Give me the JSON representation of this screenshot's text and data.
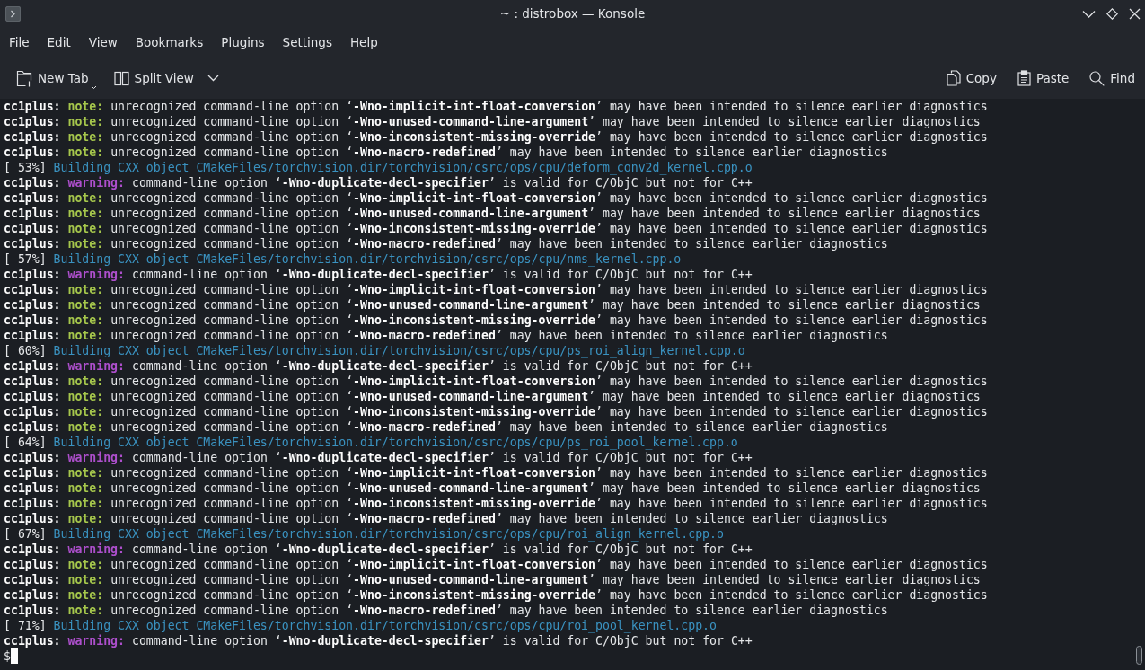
{
  "window": {
    "title": "~ : distrobox — Konsole"
  },
  "menu_bar": [
    "File",
    "Edit",
    "View",
    "Bookmarks",
    "Plugins",
    "Settings",
    "Help"
  ],
  "toolbar": {
    "left": [
      {
        "kind": "new-tab",
        "label": "New Tab",
        "has_menu": true,
        "split_button": false
      },
      {
        "kind": "split-view",
        "label": "Split View",
        "has_menu": true,
        "split_button": true
      }
    ],
    "right": [
      {
        "kind": "copy",
        "label": "Copy"
      },
      {
        "kind": "paste",
        "label": "Paste"
      },
      {
        "kind": "find",
        "label": "Find"
      }
    ]
  },
  "terminal": {
    "lines": [
      {
        "kind": "note",
        "source": "cc1plus:",
        "severity": "note:",
        "message": "unrecognized command-line option ‘**-Wno-implicit-int-float-conversion**’ may have been intended to silence earlier diagnostics"
      },
      {
        "kind": "note",
        "source": "cc1plus:",
        "severity": "note:",
        "message": "unrecognized command-line option ‘**-Wno-unused-command-line-argument**’ may have been intended to silence earlier diagnostics"
      },
      {
        "kind": "note",
        "source": "cc1plus:",
        "severity": "note:",
        "message": "unrecognized command-line option ‘**-Wno-inconsistent-missing-override**’ may have been intended to silence earlier diagnostics"
      },
      {
        "kind": "note",
        "source": "cc1plus:",
        "severity": "note:",
        "message": "unrecognized command-line option ‘**-Wno-macro-redefined**’ may have been intended to silence earlier diagnostics"
      },
      {
        "kind": "progress",
        "percent": "[ 53%]",
        "message": "Building CXX object CMakeFiles/torchvision.dir/torchvision/csrc/ops/cpu/deform_conv2d_kernel.cpp.o"
      },
      {
        "kind": "warning",
        "source": "cc1plus:",
        "severity": "warning:",
        "message": "command-line option ‘**-Wno-duplicate-decl-specifier**’ is valid for C/ObjC but not for C++"
      },
      {
        "kind": "note",
        "source": "cc1plus:",
        "severity": "note:",
        "message": "unrecognized command-line option ‘**-Wno-implicit-int-float-conversion**’ may have been intended to silence earlier diagnostics"
      },
      {
        "kind": "note",
        "source": "cc1plus:",
        "severity": "note:",
        "message": "unrecognized command-line option ‘**-Wno-unused-command-line-argument**’ may have been intended to silence earlier diagnostics"
      },
      {
        "kind": "note",
        "source": "cc1plus:",
        "severity": "note:",
        "message": "unrecognized command-line option ‘**-Wno-inconsistent-missing-override**’ may have been intended to silence earlier diagnostics"
      },
      {
        "kind": "note",
        "source": "cc1plus:",
        "severity": "note:",
        "message": "unrecognized command-line option ‘**-Wno-macro-redefined**’ may have been intended to silence earlier diagnostics"
      },
      {
        "kind": "progress",
        "percent": "[ 57%]",
        "message": "Building CXX object CMakeFiles/torchvision.dir/torchvision/csrc/ops/cpu/nms_kernel.cpp.o"
      },
      {
        "kind": "warning",
        "source": "cc1plus:",
        "severity": "warning:",
        "message": "command-line option ‘**-Wno-duplicate-decl-specifier**’ is valid for C/ObjC but not for C++"
      },
      {
        "kind": "note",
        "source": "cc1plus:",
        "severity": "note:",
        "message": "unrecognized command-line option ‘**-Wno-implicit-int-float-conversion**’ may have been intended to silence earlier diagnostics"
      },
      {
        "kind": "note",
        "source": "cc1plus:",
        "severity": "note:",
        "message": "unrecognized command-line option ‘**-Wno-unused-command-line-argument**’ may have been intended to silence earlier diagnostics"
      },
      {
        "kind": "note",
        "source": "cc1plus:",
        "severity": "note:",
        "message": "unrecognized command-line option ‘**-Wno-inconsistent-missing-override**’ may have been intended to silence earlier diagnostics"
      },
      {
        "kind": "note",
        "source": "cc1plus:",
        "severity": "note:",
        "message": "unrecognized command-line option ‘**-Wno-macro-redefined**’ may have been intended to silence earlier diagnostics"
      },
      {
        "kind": "progress",
        "percent": "[ 60%]",
        "message": "Building CXX object CMakeFiles/torchvision.dir/torchvision/csrc/ops/cpu/ps_roi_align_kernel.cpp.o"
      },
      {
        "kind": "warning",
        "source": "cc1plus:",
        "severity": "warning:",
        "message": "command-line option ‘**-Wno-duplicate-decl-specifier**’ is valid for C/ObjC but not for C++"
      },
      {
        "kind": "note",
        "source": "cc1plus:",
        "severity": "note:",
        "message": "unrecognized command-line option ‘**-Wno-implicit-int-float-conversion**’ may have been intended to silence earlier diagnostics"
      },
      {
        "kind": "note",
        "source": "cc1plus:",
        "severity": "note:",
        "message": "unrecognized command-line option ‘**-Wno-unused-command-line-argument**’ may have been intended to silence earlier diagnostics"
      },
      {
        "kind": "note",
        "source": "cc1plus:",
        "severity": "note:",
        "message": "unrecognized command-line option ‘**-Wno-inconsistent-missing-override**’ may have been intended to silence earlier diagnostics"
      },
      {
        "kind": "note",
        "source": "cc1plus:",
        "severity": "note:",
        "message": "unrecognized command-line option ‘**-Wno-macro-redefined**’ may have been intended to silence earlier diagnostics"
      },
      {
        "kind": "progress",
        "percent": "[ 64%]",
        "message": "Building CXX object CMakeFiles/torchvision.dir/torchvision/csrc/ops/cpu/ps_roi_pool_kernel.cpp.o"
      },
      {
        "kind": "warning",
        "source": "cc1plus:",
        "severity": "warning:",
        "message": "command-line option ‘**-Wno-duplicate-decl-specifier**’ is valid for C/ObjC but not for C++"
      },
      {
        "kind": "note",
        "source": "cc1plus:",
        "severity": "note:",
        "message": "unrecognized command-line option ‘**-Wno-implicit-int-float-conversion**’ may have been intended to silence earlier diagnostics"
      },
      {
        "kind": "note",
        "source": "cc1plus:",
        "severity": "note:",
        "message": "unrecognized command-line option ‘**-Wno-unused-command-line-argument**’ may have been intended to silence earlier diagnostics"
      },
      {
        "kind": "note",
        "source": "cc1plus:",
        "severity": "note:",
        "message": "unrecognized command-line option ‘**-Wno-inconsistent-missing-override**’ may have been intended to silence earlier diagnostics"
      },
      {
        "kind": "note",
        "source": "cc1plus:",
        "severity": "note:",
        "message": "unrecognized command-line option ‘**-Wno-macro-redefined**’ may have been intended to silence earlier diagnostics"
      },
      {
        "kind": "progress",
        "percent": "[ 67%]",
        "message": "Building CXX object CMakeFiles/torchvision.dir/torchvision/csrc/ops/cpu/roi_align_kernel.cpp.o"
      },
      {
        "kind": "warning",
        "source": "cc1plus:",
        "severity": "warning:",
        "message": "command-line option ‘**-Wno-duplicate-decl-specifier**’ is valid for C/ObjC but not for C++"
      },
      {
        "kind": "note",
        "source": "cc1plus:",
        "severity": "note:",
        "message": "unrecognized command-line option ‘**-Wno-implicit-int-float-conversion**’ may have been intended to silence earlier diagnostics"
      },
      {
        "kind": "note",
        "source": "cc1plus:",
        "severity": "note:",
        "message": "unrecognized command-line option ‘**-Wno-unused-command-line-argument**’ may have been intended to silence earlier diagnostics"
      },
      {
        "kind": "note",
        "source": "cc1plus:",
        "severity": "note:",
        "message": "unrecognized command-line option ‘**-Wno-inconsistent-missing-override**’ may have been intended to silence earlier diagnostics"
      },
      {
        "kind": "note",
        "source": "cc1plus:",
        "severity": "note:",
        "message": "unrecognized command-line option ‘**-Wno-macro-redefined**’ may have been intended to silence earlier diagnostics"
      },
      {
        "kind": "progress",
        "percent": "[ 71%]",
        "message": "Building CXX object CMakeFiles/torchvision.dir/torchvision/csrc/ops/cpu/roi_pool_kernel.cpp.o"
      },
      {
        "kind": "warning",
        "source": "cc1plus:",
        "severity": "warning:",
        "message": "command-line option ‘**-Wno-duplicate-decl-specifier**’ is valid for C/ObjC but not for C++"
      }
    ],
    "prompt": {
      "symbol": "$"
    }
  }
}
